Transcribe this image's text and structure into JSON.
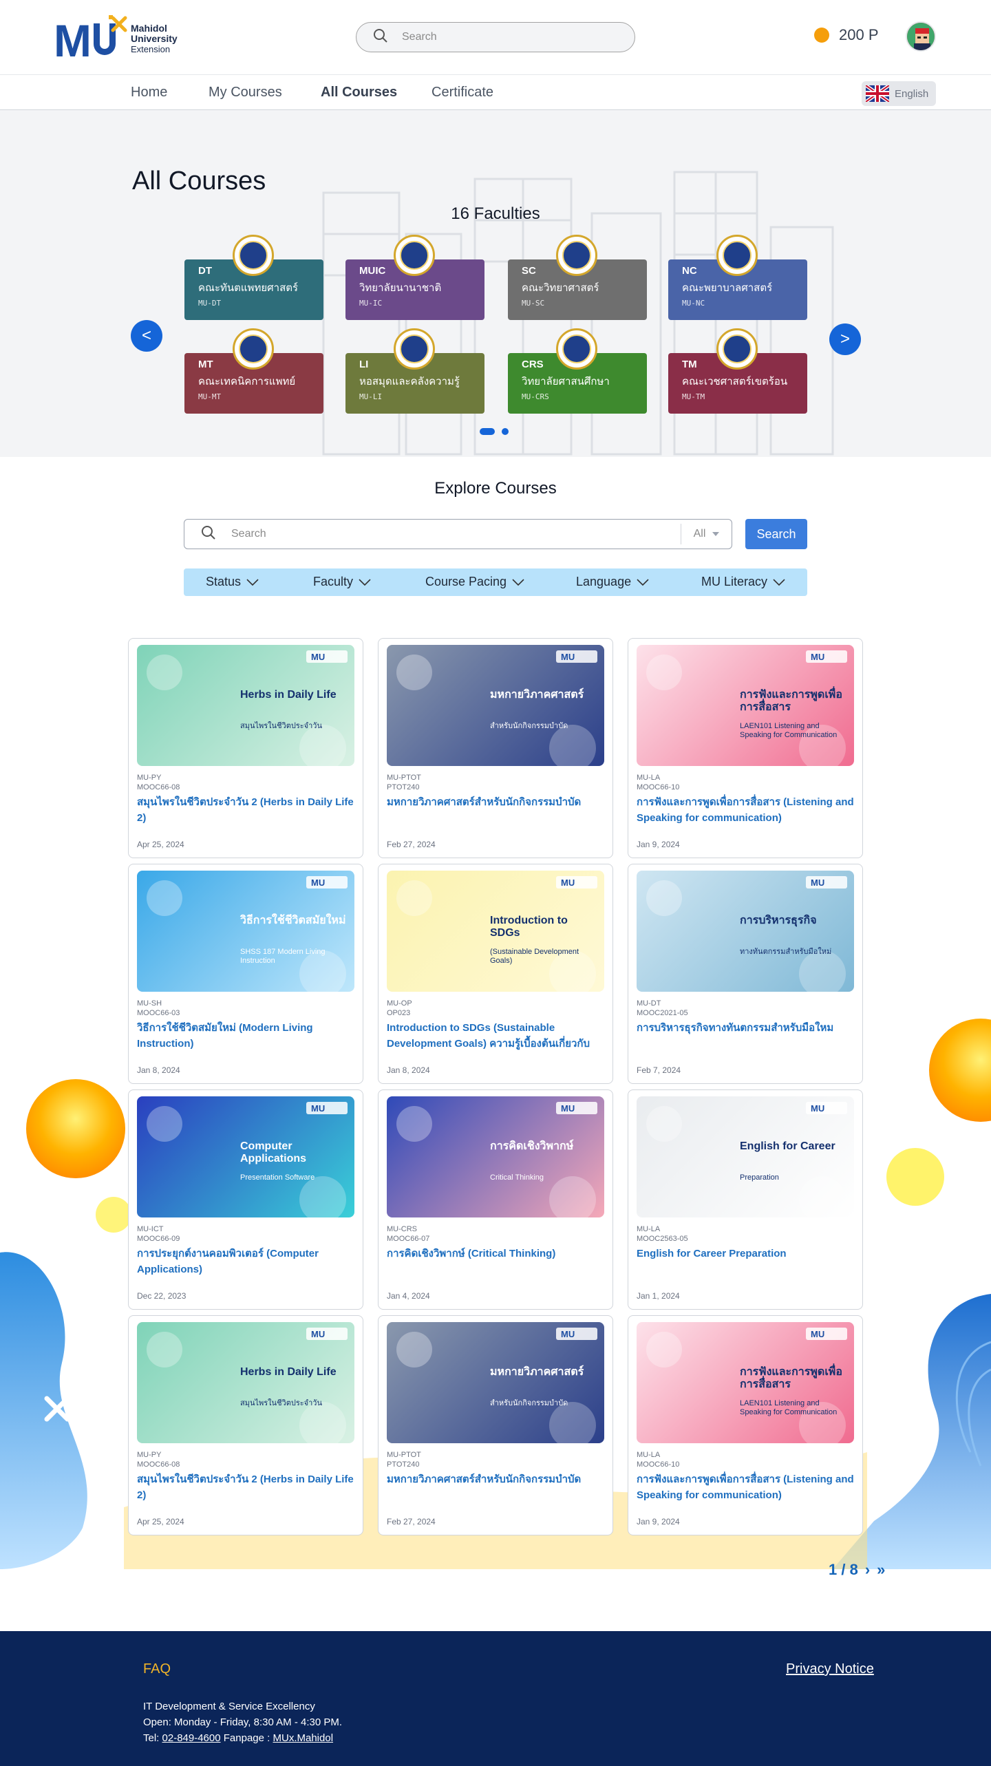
{
  "header": {
    "logo_line1": "Mahidol",
    "logo_line2": "University",
    "logo_line3": "Extension",
    "search_placeholder": "Search",
    "points": "200 P"
  },
  "nav": {
    "items": [
      "Home",
      "My Courses",
      "All Courses",
      "Certificate"
    ],
    "active": "All Courses",
    "language": "English"
  },
  "hero": {
    "title": "All Courses",
    "faculty_count": "16 Faculties",
    "prev": "<",
    "next": ">",
    "faculties": [
      {
        "code": "DT",
        "name": "คณะทันตแพทยศาสตร์",
        "sub": "MU-DT",
        "color": "#2e6d7a"
      },
      {
        "code": "MUIC",
        "name": "วิทยาลัยนานาชาติ",
        "sub": "MU-IC",
        "color": "#6b4a8a"
      },
      {
        "code": "SC",
        "name": "คณะวิทยาศาสตร์",
        "sub": "MU-SC",
        "color": "#6f6f6f"
      },
      {
        "code": "NC",
        "name": "คณะพยาบาลศาสตร์",
        "sub": "MU-NC",
        "color": "#4a64a8"
      },
      {
        "code": "MT",
        "name": "คณะเทคนิคการแพทย์",
        "sub": "MU-MT",
        "color": "#8a3a44"
      },
      {
        "code": "LI",
        "name": "หอสมุดและคลังความรู้",
        "sub": "MU-LI",
        "color": "#6e7a3c"
      },
      {
        "code": "CRS",
        "name": "วิทยาลัยศาสนศึกษา",
        "sub": "MU-CRS",
        "color": "#3e8a2e"
      },
      {
        "code": "TM",
        "name": "คณะเวชศาสตร์เขตร้อน",
        "sub": "MU-TM",
        "color": "#8a2e48"
      }
    ]
  },
  "explore": {
    "title": "Explore Courses",
    "search_placeholder": "Search",
    "scope": "All",
    "search_button": "Search",
    "filters": [
      "Status",
      "Faculty",
      "Course Pacing",
      "Language",
      "MU Literacy"
    ]
  },
  "courses": [
    {
      "faculty": "MU-PY",
      "code": "MOOC66-08",
      "title": "สมุนไพรในชีวิตประจำวัน 2 (Herbs in Daily Life 2)",
      "date": "Apr 25, 2024",
      "thumb_text": "Herbs in Daily Life",
      "thumb_sub": "สมุนไพรในชีวิตประจำวัน",
      "bg1": "#7fd3b8",
      "bg2": "#d9f1e4"
    },
    {
      "faculty": "MU-PTOT",
      "code": "PTOT240",
      "title": "มหกายวิภาคศาสตร์สำหรับนักกิจกรรมบำบัด",
      "date": "Feb 27, 2024",
      "thumb_text": "มหกายวิภาคศาสตร์",
      "thumb_sub": "สำหรับนักกิจกรรมบำบัด",
      "bg1": "#8a98ad",
      "bg2": "#2b3f8a"
    },
    {
      "faculty": "MU-LA",
      "code": "MOOC66-10",
      "title": "การฟังและการพูดเพื่อการสื่อสาร (Listening and Speaking for communication)",
      "date": "Jan 9, 2024",
      "thumb_text": "การฟังและการพูดเพื่อการสื่อสาร",
      "thumb_sub": "LAEN101 Listening and Speaking for Communication",
      "bg1": "#fde2ea",
      "bg2": "#f06b8f"
    },
    {
      "faculty": "MU-SH",
      "code": "MOOC66-03",
      "title": "วิธีการใช้ชีวิตสมัยใหม่ (Modern Living Instruction)",
      "date": "Jan 8, 2024",
      "thumb_text": "วิธีการใช้ชีวิตสมัยใหม่",
      "thumb_sub": "SHSS 187 Modern Living Instruction",
      "bg1": "#3aa8e8",
      "bg2": "#bfe7fb"
    },
    {
      "faculty": "MU-OP",
      "code": "OP023",
      "title": "Introduction to SDGs (Sustainable Development Goals) ความรู้เบื้องต้นเกี่ยวกับเป้าหมายการพัฒนาอย่างยั่งยืน",
      "date": "Jan 8, 2024",
      "thumb_text": "Introduction to SDGs",
      "thumb_sub": "(Sustainable Development Goals)",
      "bg1": "#fbf3b0",
      "bg2": "#fff9d6"
    },
    {
      "faculty": "MU-DT",
      "code": "MOOC2021-05",
      "title": "การบริหารธุรกิจทางทันตกรรมสำหรับมือใหม",
      "date": "Feb 7, 2024",
      "thumb_text": "การบริหารธุรกิจ",
      "thumb_sub": "ทางทันตกรรมสำหรับมือใหม่",
      "bg1": "#cfe6f2",
      "bg2": "#7fb8d6"
    },
    {
      "faculty": "MU-ICT",
      "code": "MOOC66-09",
      "title": "การประยุกต์งานคอมพิวเตอร์ (Computer Applications)",
      "date": "Dec 22, 2023",
      "thumb_text": "Computer Applications",
      "thumb_sub": "Presentation Software",
      "bg1": "#2a3fbf",
      "bg2": "#3ad0d8"
    },
    {
      "faculty": "MU-CRS",
      "code": "MOOC66-07",
      "title": "การคิดเชิงวิพากษ์ (Critical Thinking)",
      "date": "Jan 4, 2024",
      "thumb_text": "การคิดเชิงวิพากษ์",
      "thumb_sub": "Critical Thinking",
      "bg1": "#2f4ab8",
      "bg2": "#f6a9b8"
    },
    {
      "faculty": "MU-LA",
      "code": "MOOC2563-05",
      "title": "English for Career Preparation",
      "date": "Jan 1, 2024",
      "thumb_text": "English for Career",
      "thumb_sub": "Preparation",
      "bg1": "#e9ecef",
      "bg2": "#ffffff"
    },
    {
      "faculty": "MU-PY",
      "code": "MOOC66-08",
      "title": "สมุนไพรในชีวิตประจำวัน 2 (Herbs in Daily Life 2)",
      "date": "Apr 25, 2024",
      "thumb_text": "Herbs in Daily Life",
      "thumb_sub": "สมุนไพรในชีวิตประจำวัน",
      "bg1": "#7fd3b8",
      "bg2": "#d9f1e4"
    },
    {
      "faculty": "MU-PTOT",
      "code": "PTOT240",
      "title": "มหกายวิภาคศาสตร์สำหรับนักกิจกรรมบำบัด",
      "date": "Feb 27, 2024",
      "thumb_text": "มหกายวิภาคศาสตร์",
      "thumb_sub": "สำหรับนักกิจกรรมบำบัด",
      "bg1": "#8a98ad",
      "bg2": "#2b3f8a"
    },
    {
      "faculty": "MU-LA",
      "code": "MOOC66-10",
      "title": "การฟังและการพูดเพื่อการสื่อสาร (Listening and Speaking for communication)",
      "date": "Jan 9, 2024",
      "thumb_text": "การฟังและการพูดเพื่อการสื่อสาร",
      "thumb_sub": "LAEN101 Listening and Speaking for Communication",
      "bg1": "#fde2ea",
      "bg2": "#f06b8f"
    }
  ],
  "pagination": {
    "label": "1 / 8",
    "next": "›",
    "last": "»"
  },
  "footer": {
    "faq": "FAQ",
    "privacy": "Privacy Notice",
    "line1": "IT Development & Service Excellency",
    "line2": "Open: Monday - Friday, 8:30 AM - 4:30 PM.",
    "tel_label": "Tel:",
    "tel": "02-849-4600",
    "fanpage_label": "Fanpage :",
    "fanpage": "MUx.Mahidol"
  },
  "colors": {
    "primary": "#1565d8",
    "link": "#1f6fbf",
    "footer_bg": "#0b2559",
    "faq": "#f0b429",
    "filter_bg": "#b8e2fb"
  }
}
